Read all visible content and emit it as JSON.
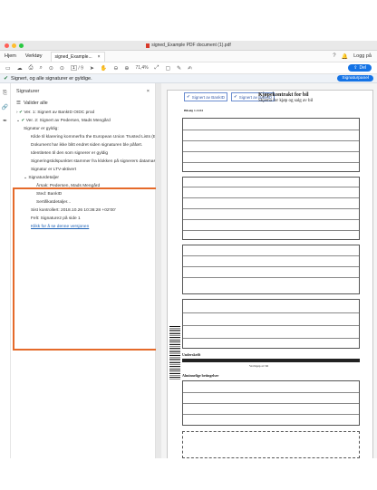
{
  "window": {
    "title": "signed_Example PDF document (1).pdf",
    "traffic_colors": [
      "#ff5f57",
      "#ffbd2e",
      "#28c840"
    ]
  },
  "menu": {
    "items": [
      "Hjem",
      "Verktøy"
    ],
    "doc_tab": "signed_Example...",
    "doc_tab_close": "×",
    "login": "Logg på"
  },
  "toolbar": {
    "page_current": "1",
    "page_total": "/ 9",
    "zoom": "71,4%",
    "share_label": "Del"
  },
  "signature_bar": {
    "message": "Signert, og alle signaturer er gyldige.",
    "panel_button": "Signaturpanel"
  },
  "panel": {
    "title": "Signaturer",
    "validate_label": "Valider alle",
    "sig1": "Ver. 1: Signert av BankID OIDC prod",
    "sig2": "Ver. 2: Signert av Pedersen, Mads Mengård",
    "details": [
      "Signatur er gyldig:",
      "Kilde til klarering kommerfra the European Union Trusted Lists (EUTL).",
      "Dokument har ikke blitt endret siden signaturen ble påført.",
      "Identiteten til den som signerer er gyldig",
      "Signeringstidspunktet stammer fra klokken på signerers datamaskin",
      "Signatur er LTV-aktivert"
    ],
    "sig_details_label": "Signaturdetaljer",
    "sig_details": [
      "Årsak: Pedersen, Mads Mengård",
      "Sted: BankID",
      "Sertifikatdetaljer..."
    ],
    "last_checked": "Sist kontrollert: 2018.10.26 10:36:28 +02'00'",
    "field": "Felt: Signature2 på side 1",
    "link": "Klikk for å se denne versjonen"
  },
  "document": {
    "stamp_left": "Signert av BankID",
    "stamp_right": "Signert av BankID",
    "heading": "Kjøpekontrakt for bil",
    "subheading": "Skjema for kjøp og salg av bil",
    "form_id": "Bilsalg  1-1234",
    "signature_header": "Underskrift",
    "signature_name": "Ved kjøp av bil",
    "conditions_title": "Alminnelige betingelser"
  }
}
